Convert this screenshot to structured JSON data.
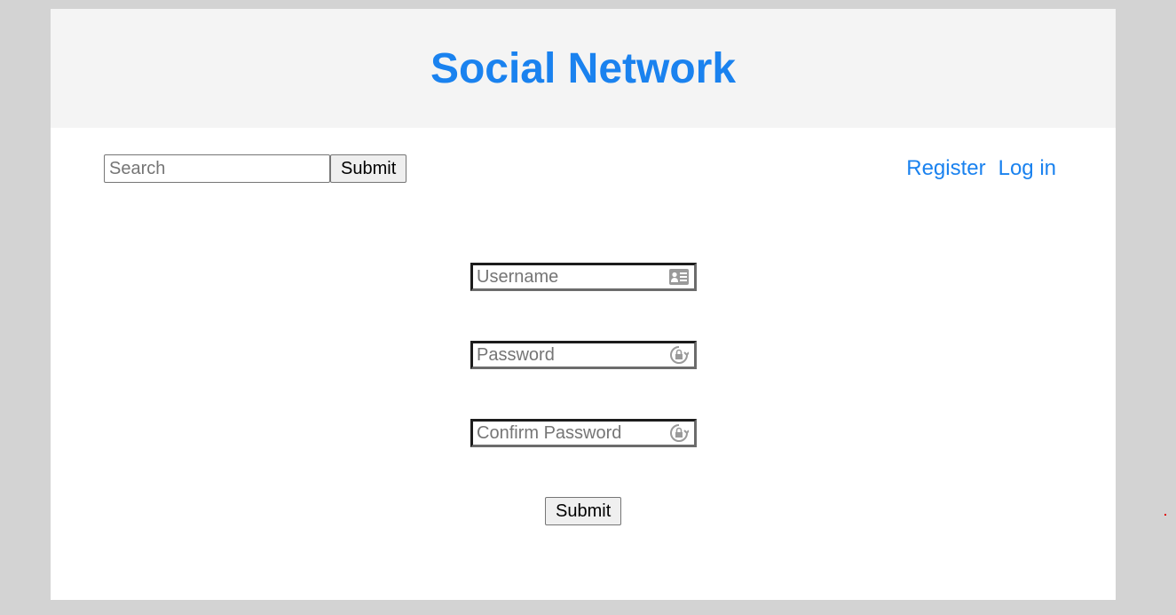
{
  "header": {
    "title": "Social Network"
  },
  "search": {
    "placeholder": "Search",
    "submit_label": "Submit"
  },
  "nav": {
    "register_label": "Register",
    "login_label": "Log in"
  },
  "form": {
    "username_placeholder": "Username",
    "password_placeholder": "Password",
    "confirm_password_placeholder": "Confirm Password",
    "submit_label": "Submit",
    "username_icon": "id-card-icon",
    "password_icon": "password-lock-icon",
    "confirm_password_icon": "password-lock-icon"
  },
  "colors": {
    "brand": "#1a82ef",
    "header_bg": "#f4f4f4",
    "page_bg": "#d3d3d3"
  }
}
